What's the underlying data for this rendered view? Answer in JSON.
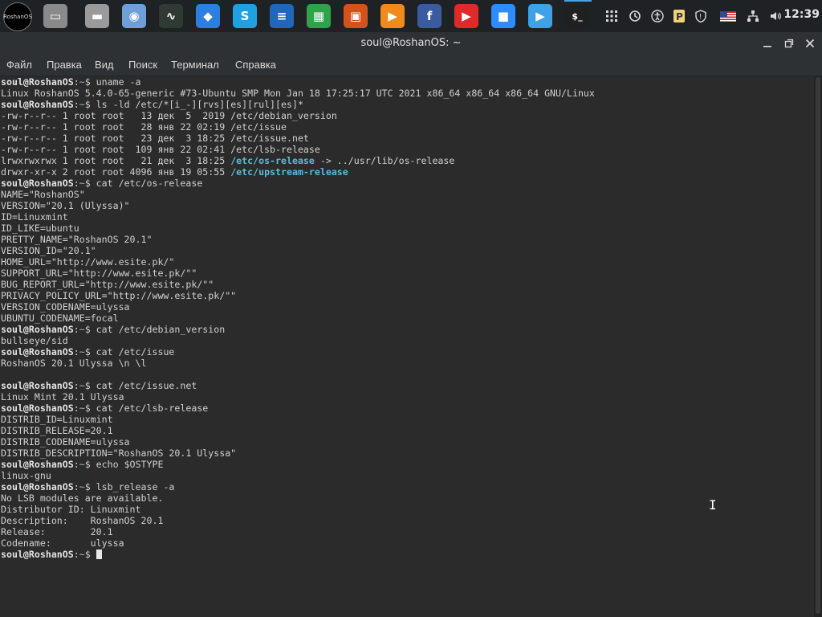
{
  "panel": {
    "logo_text": "RoshanOS",
    "clock": "12:39",
    "launchers": [
      {
        "name": "files-app",
        "color": "#8a8a8a"
      },
      {
        "name": "folder-app",
        "color": "#9a9a9a"
      },
      {
        "name": "browser-app",
        "color": "#6f9fd8"
      },
      {
        "name": "system-monitor-app",
        "color": "#2f3a33"
      },
      {
        "name": "dropbox-app",
        "color": "#2a7fe0"
      },
      {
        "name": "skype-app",
        "color": "#1fa0e0"
      },
      {
        "name": "writer-app",
        "color": "#2167b8"
      },
      {
        "name": "calc-app",
        "color": "#2da44a"
      },
      {
        "name": "impress-app",
        "color": "#d4531d"
      },
      {
        "name": "media-player-app",
        "color": "#f08a1c"
      },
      {
        "name": "facebook-app",
        "color": "#3a5ba0"
      },
      {
        "name": "youtube-app",
        "color": "#e02a2a"
      },
      {
        "name": "zoom-app",
        "color": "#2d8cff"
      },
      {
        "name": "video-app",
        "color": "#3ea3e6"
      },
      {
        "name": "terminal-app",
        "color": "#202020"
      }
    ]
  },
  "window": {
    "title": "soul@RoshanOS: ~",
    "menu": [
      "Файл",
      "Правка",
      "Вид",
      "Поиск",
      "Терминал",
      "Справка"
    ]
  },
  "terminal": {
    "user": "soul",
    "host": "RoshanOS",
    "path": "~",
    "lines": [
      {
        "t": "p",
        "cmd": "uname -a"
      },
      {
        "t": "o",
        "text": "Linux RoshanOS 5.4.0-65-generic #73-Ubuntu SMP Mon Jan 18 17:25:17 UTC 2021 x86_64 x86_64 x86_64 GNU/Linux"
      },
      {
        "t": "p",
        "cmd": "ls -ld /etc/*[i_-][rvs][es][rul][es]*"
      },
      {
        "t": "o",
        "text": "-rw-r--r-- 1 root root   13 дек  5  2019 /etc/debian_version"
      },
      {
        "t": "o",
        "text": "-rw-r--r-- 1 root root   28 янв 22 02:19 /etc/issue"
      },
      {
        "t": "o",
        "text": "-rw-r--r-- 1 root root   23 дек  3 18:25 /etc/issue.net"
      },
      {
        "t": "o",
        "text": "-rw-r--r-- 1 root root  109 янв 22 02:41 /etc/lsb-release"
      },
      {
        "t": "l",
        "pre": "lrwxrwxrwx 1 root root   21 дек  3 18:25 ",
        "link": "/etc/os-release",
        "post": " -> ../usr/lib/os-release"
      },
      {
        "t": "l",
        "pre": "drwxr-xr-x 2 root root 4096 янв 19 05:55 ",
        "link": "/etc/upstream-release",
        "post": ""
      },
      {
        "t": "p",
        "cmd": "cat /etc/os-release"
      },
      {
        "t": "o",
        "text": "NAME=\"RoshanOS\""
      },
      {
        "t": "o",
        "text": "VERSION=\"20.1 (Ulyssa)\""
      },
      {
        "t": "o",
        "text": "ID=Linuxmint"
      },
      {
        "t": "o",
        "text": "ID_LIKE=ubuntu"
      },
      {
        "t": "o",
        "text": "PRETTY_NAME=\"RoshanOS 20.1\""
      },
      {
        "t": "o",
        "text": "VERSION_ID=\"20.1\""
      },
      {
        "t": "o",
        "text": "HOME_URL=\"http://www.esite.pk/\""
      },
      {
        "t": "o",
        "text": "SUPPORT_URL=\"http://www.esite.pk/\"\""
      },
      {
        "t": "o",
        "text": "BUG_REPORT_URL=\"http://www.esite.pk/\"\""
      },
      {
        "t": "o",
        "text": "PRIVACY_POLICY_URL=\"http://www.esite.pk/\"\""
      },
      {
        "t": "o",
        "text": "VERSION_CODENAME=ulyssa"
      },
      {
        "t": "o",
        "text": "UBUNTU_CODENAME=focal"
      },
      {
        "t": "p",
        "cmd": "cat /etc/debian_version"
      },
      {
        "t": "o",
        "text": "bullseye/sid"
      },
      {
        "t": "p",
        "cmd": "cat /etc/issue"
      },
      {
        "t": "o",
        "text": "RoshanOS 20.1 Ulyssa \\n \\l"
      },
      {
        "t": "o",
        "text": ""
      },
      {
        "t": "p",
        "cmd": "cat /etc/issue.net"
      },
      {
        "t": "o",
        "text": "Linux Mint 20.1 Ulyssa"
      },
      {
        "t": "p",
        "cmd": "cat /etc/lsb-release"
      },
      {
        "t": "o",
        "text": "DISTRIB_ID=Linuxmint"
      },
      {
        "t": "o",
        "text": "DISTRIB_RELEASE=20.1"
      },
      {
        "t": "o",
        "text": "DISTRIB_CODENAME=ulyssa"
      },
      {
        "t": "o",
        "text": "DISTRIB_DESCRIPTION=\"RoshanOS 20.1 Ulyssa\""
      },
      {
        "t": "p",
        "cmd": "echo $OSTYPE"
      },
      {
        "t": "o",
        "text": "linux-gnu"
      },
      {
        "t": "p",
        "cmd": "lsb_release -a"
      },
      {
        "t": "o",
        "text": "No LSB modules are available."
      },
      {
        "t": "o",
        "text": "Distributor ID:\tLinuxmint"
      },
      {
        "t": "o",
        "text": "Description:\tRoshanOS 20.1"
      },
      {
        "t": "o",
        "text": "Release:\t20.1"
      },
      {
        "t": "o",
        "text": "Codename:\tulyssa"
      },
      {
        "t": "c",
        "cmd": ""
      }
    ]
  }
}
